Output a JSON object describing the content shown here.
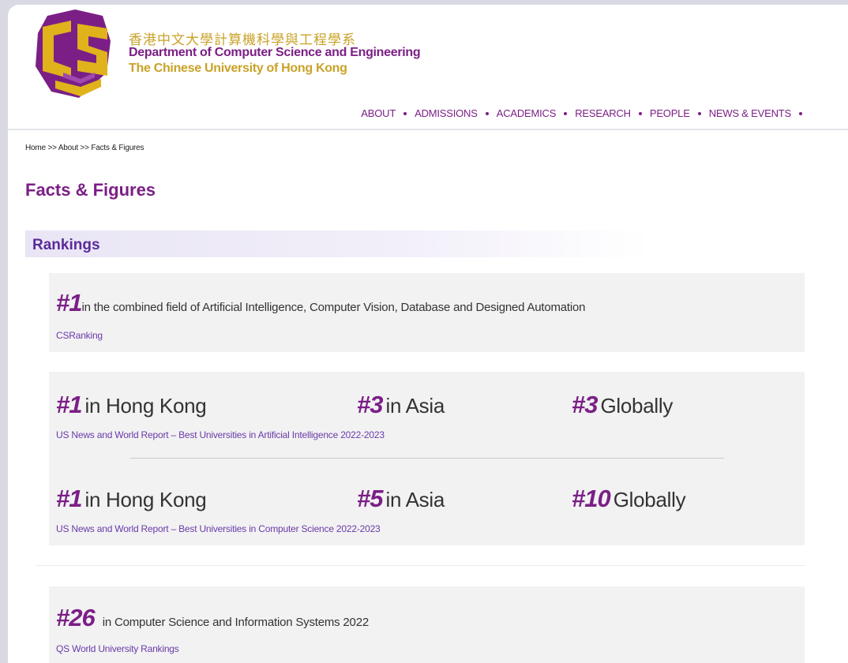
{
  "header": {
    "dept_name_chinese": "香港中文大學計算機科學與工程學系",
    "dept_name_english": "Department of Computer Science and Engineering",
    "university_name": "The Chinese University of Hong Kong",
    "logo_icon": "cse-logo-icon"
  },
  "nav": {
    "items": [
      "ABOUT",
      "ADMISSIONS",
      "ACADEMICS",
      "RESEARCH",
      "PEOPLE",
      "NEWS & EVENTS"
    ]
  },
  "breadcrumb": "Home >> About >> Facts & Figures",
  "page_title": "Facts & Figures",
  "section_title": "Rankings",
  "rankings": {
    "csranking": {
      "rank": "#1",
      "description": "in the combined field of Artificial Intelligence, Computer Vision, Database and Designed Automation",
      "source": "CSRanking"
    },
    "usnews_ai": {
      "hk_rank": "#1",
      "hk_label": "in Hong Kong",
      "asia_rank": "#3",
      "asia_label": "in Asia",
      "global_rank": "#3",
      "global_label": "Globally",
      "source": "US News and World Report – Best Universities in Artificial Intelligence 2022-2023"
    },
    "usnews_cs": {
      "hk_rank": "#1",
      "hk_label": "in Hong Kong",
      "asia_rank": "#5",
      "asia_label": "in Asia",
      "global_rank": "#10",
      "global_label": "Globally",
      "source": "US News and World Report – Best Universities in Computer Science 2022-2023"
    },
    "qs": {
      "rank": "#26",
      "description": "in Computer Science and Information Systems 2022",
      "source": "QS World University Rankings"
    }
  },
  "colors": {
    "brand_purple": "#7b1f86",
    "brand_gold": "#c9a227",
    "link_purple": "#6a3aa8"
  }
}
